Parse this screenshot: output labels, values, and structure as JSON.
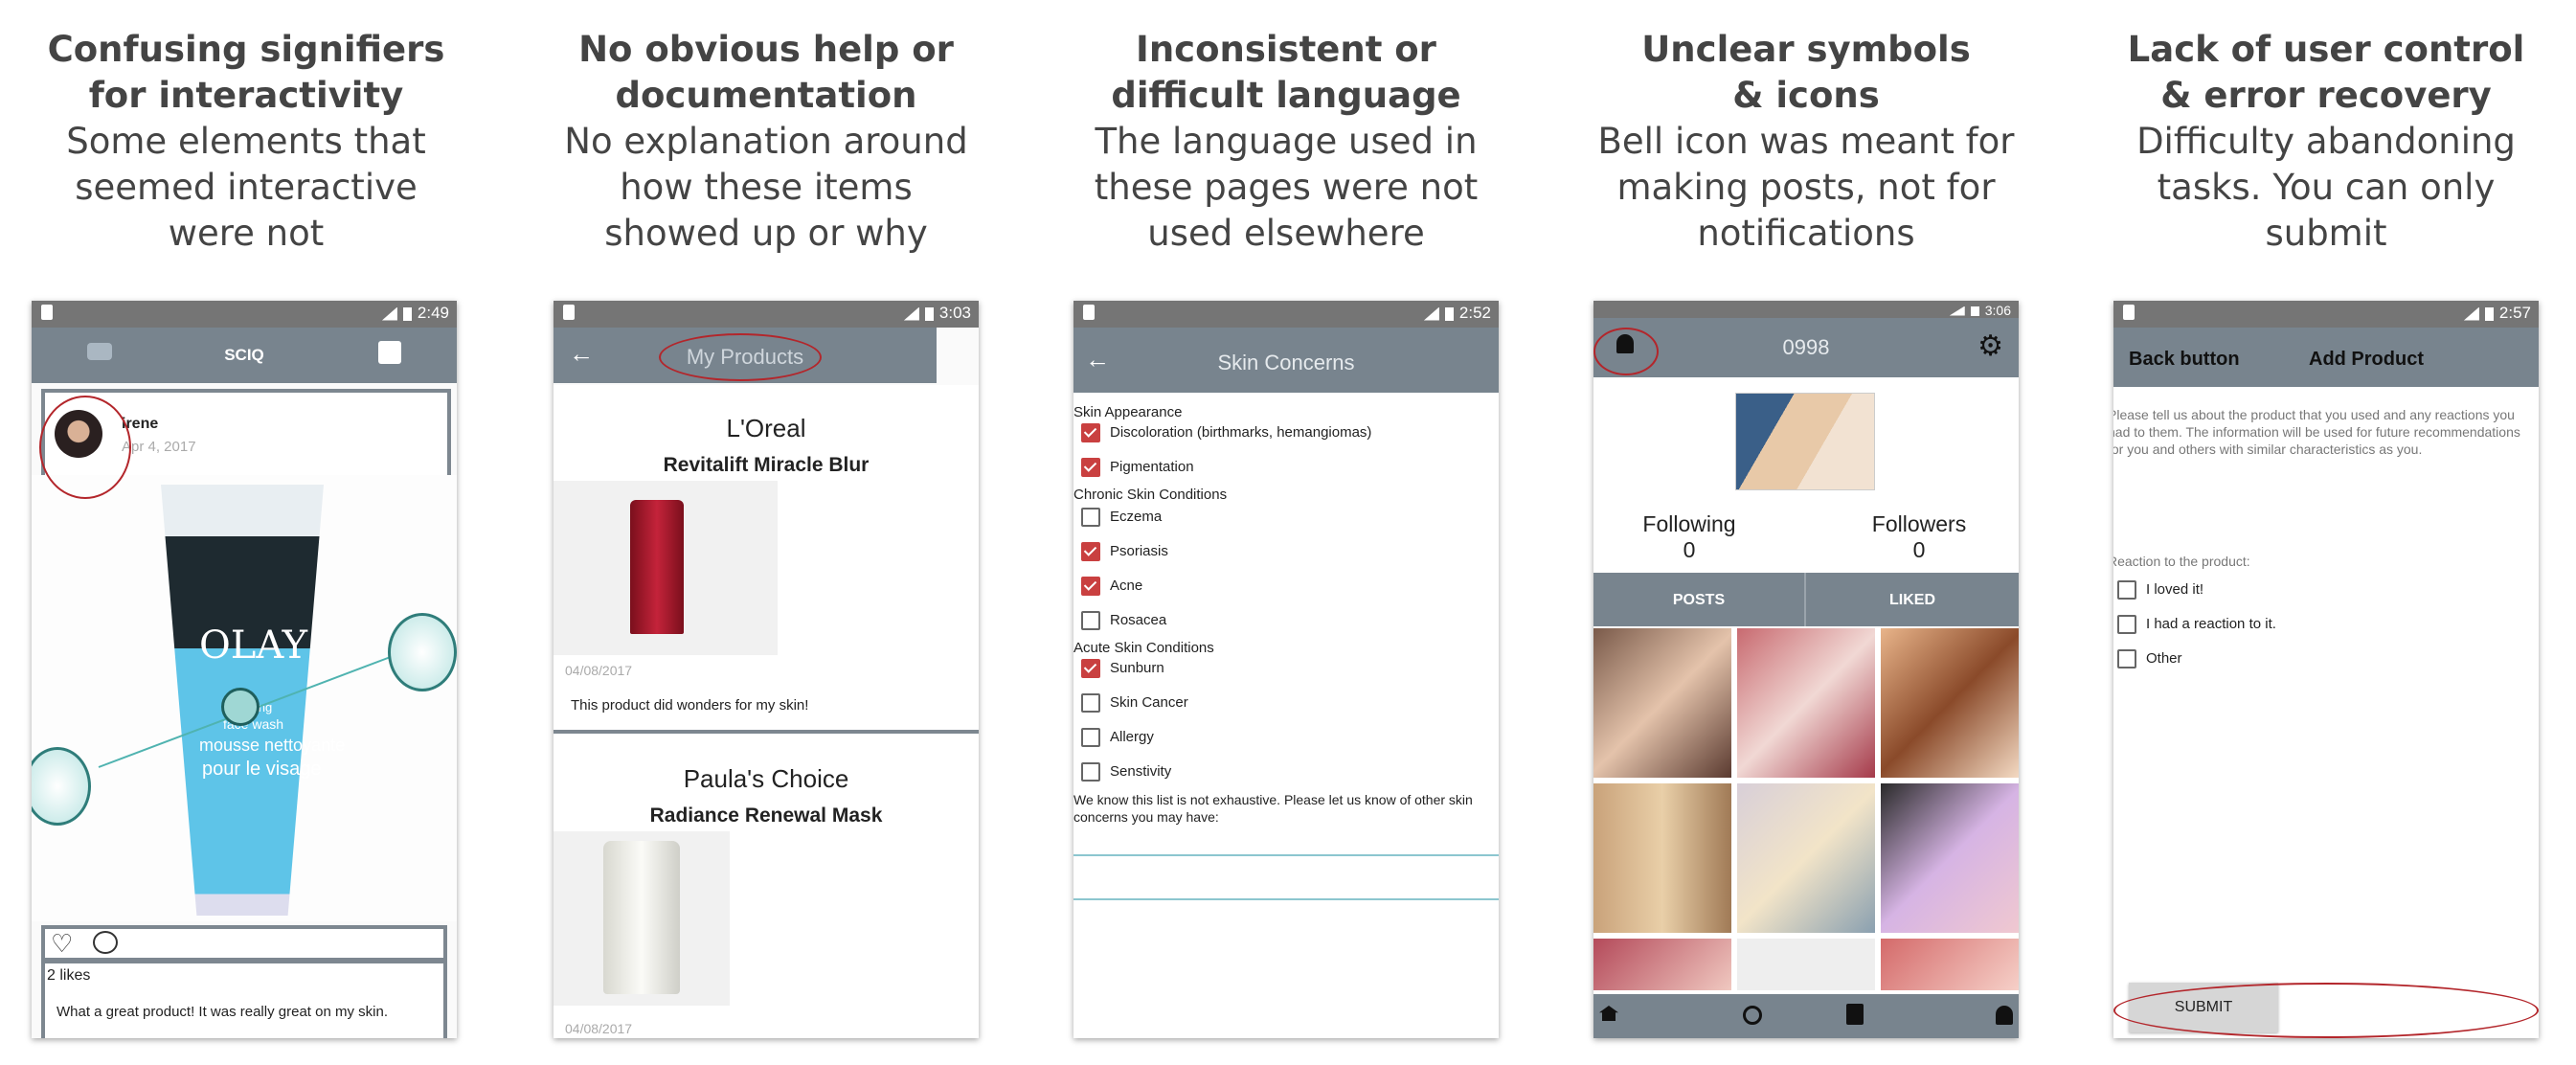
{
  "panels": [
    {
      "heading_line1": "Confusing signifiers",
      "heading_line2": "for interactivity",
      "body_line1": "Some elements that",
      "body_line2": "seemed interactive",
      "body_line3": "were not"
    },
    {
      "heading_line1": "No obvious help or",
      "heading_line2": "documentation",
      "body_line1": "No explanation around",
      "body_line2": "how these items",
      "body_line3": "showed up or why"
    },
    {
      "heading_line1": "Inconsistent or",
      "heading_line2": "difficult language",
      "body_line1": "The language used in",
      "body_line2": "these pages were not",
      "body_line3": "used elsewhere"
    },
    {
      "heading_line1": "Unclear symbols",
      "heading_line2": "& icons",
      "body_line1": "Bell icon was meant for",
      "body_line2": "making posts, not for",
      "body_line3": "notifications"
    },
    {
      "heading_line1": "Lack of user control",
      "heading_line2": "& error recovery",
      "body_line1": "Difficulty abandoning",
      "body_line2": "tasks. You can only",
      "body_line3": "submit"
    }
  ],
  "screen1": {
    "time": "2:49",
    "app_title": "SCIQ",
    "username": "irene",
    "date": "Apr 4, 2017",
    "product_brand": "OLAY",
    "product_line1": "foaming",
    "product_line2": "face wash",
    "product_line3": "mousse nettoyante",
    "product_line4": "pour le visage",
    "likes": "2 likes",
    "comment": "What a great product! It was really great on my skin."
  },
  "screen2": {
    "time": "3:03",
    "title": "My Products",
    "items": [
      {
        "brand": "L'Oreal",
        "name": "Revitalift Miracle Blur",
        "date": "04/08/2017",
        "review": "This product did wonders for my skin!"
      },
      {
        "brand": "Paula's Choice",
        "name": "Radiance Renewal Mask",
        "date": "04/08/2017",
        "review": ""
      }
    ]
  },
  "screen3": {
    "time": "2:52",
    "title": "Skin Concerns",
    "sections": [
      {
        "label": "Skin Appearance",
        "items": [
          {
            "label": "Discoloration (birthmarks, hemangiomas)",
            "checked": true
          },
          {
            "label": "Pigmentation",
            "checked": true
          }
        ]
      },
      {
        "label": "Chronic Skin Conditions",
        "items": [
          {
            "label": "Eczema",
            "checked": false
          },
          {
            "label": "Psoriasis",
            "checked": true
          },
          {
            "label": "Acne",
            "checked": true
          },
          {
            "label": "Rosacea",
            "checked": false
          }
        ]
      },
      {
        "label": "Acute Skin Conditions",
        "items": [
          {
            "label": "Sunburn",
            "checked": true
          },
          {
            "label": "Skin Cancer",
            "checked": false
          },
          {
            "label": "Allergy",
            "checked": false
          },
          {
            "label": "Senstivity",
            "checked": false
          }
        ]
      }
    ],
    "note": "We know this list is not exhaustive. Please let us know of other skin concerns you may have:"
  },
  "screen4": {
    "time": "3:06",
    "username": "0998",
    "following_label": "Following",
    "following_count": "0",
    "followers_label": "Followers",
    "followers_count": "0",
    "tab_posts": "POSTS",
    "tab_liked": "LIKED"
  },
  "screen5": {
    "time": "2:57",
    "back_label": "Back button",
    "title": "Add Product",
    "intro": "Please tell us about the product that you used and any reactions you had to them. The information will be used for future recommendations for you and others with similar characteristics as you.",
    "reaction_label": "Reaction to the product:",
    "options": [
      {
        "label": "I loved it!"
      },
      {
        "label": "I had a reaction to it."
      },
      {
        "label": "Other"
      }
    ],
    "submit": "SUBMIT"
  },
  "colors": {
    "appbar": "#78848e",
    "accent_red": "#b3262b",
    "check_red": "#c94040",
    "teal": "#4fb3b0"
  }
}
